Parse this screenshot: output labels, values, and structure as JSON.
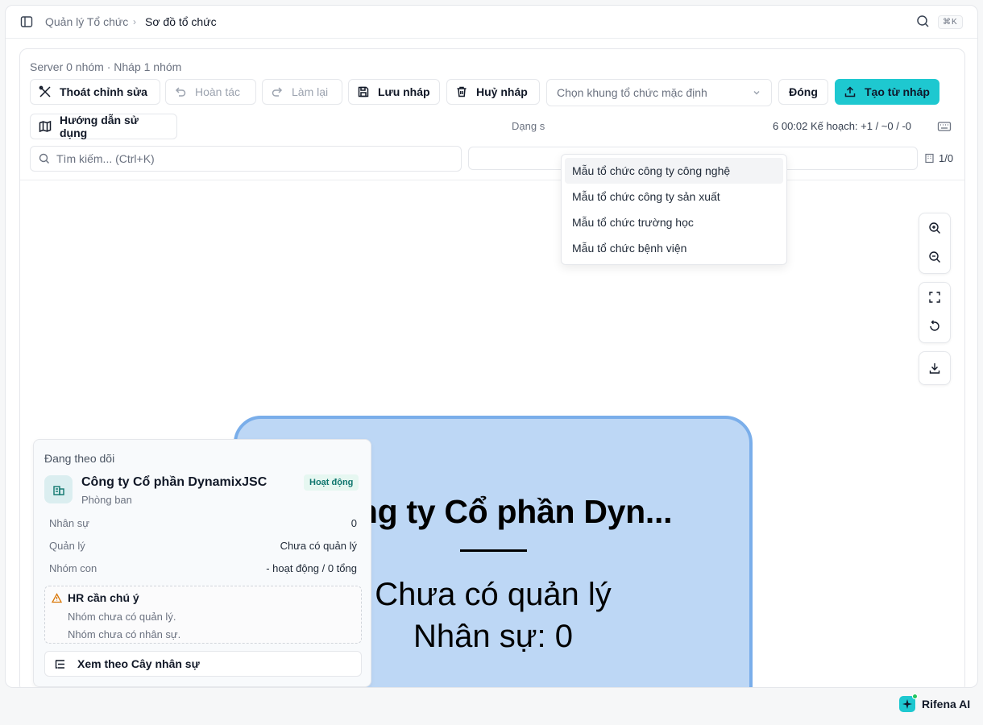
{
  "breadcrumb": {
    "parent": "Quản lý Tổ chức",
    "separator": "›",
    "current": "Sơ đồ tổ chức"
  },
  "header": {
    "shortcut": "⌘K"
  },
  "summary": "Server 0 nhóm · Nháp 1 nhóm",
  "toolbar": {
    "exit_edit": "Thoát chỉnh sửa",
    "undo": "Hoàn tác",
    "redo": "Làm lại",
    "save_draft": "Lưu nháp",
    "cancel_draft": "Huỷ nháp",
    "template_placeholder": "Chọn khung tổ chức mặc định",
    "close": "Đóng",
    "create_from_draft": "Tạo từ nháp",
    "guide": "Hướng dẫn sử dụng"
  },
  "status": {
    "left": "Dạng s",
    "right": "6 00:02  Kế hoạch: +1 / ~0 / -0"
  },
  "search": {
    "placeholder": "Tìm kiếm... (Ctrl+K)",
    "count": "1/0"
  },
  "dropdown": {
    "items": [
      "Mẫu tổ chức công ty công nghệ",
      "Mẫu tổ chức công ty sản xuất",
      "Mẫu tổ chức trường học",
      "Mẫu tổ chức bệnh viện"
    ],
    "highlighted_index": 0
  },
  "node": {
    "title": "Công ty Cổ phần Dyn...",
    "manager": "Chưa có quản lý",
    "staff": "Nhân sự: 0",
    "fill": "#bdd7f5",
    "border": "#7aaeea"
  },
  "inspector": {
    "heading": "Đang theo dõi",
    "name": "Công ty Cổ phần DynamixJSC",
    "type": "Phòng ban",
    "badge": "Hoạt động",
    "rows": [
      {
        "label": "Nhân sự",
        "value": "0"
      },
      {
        "label": "Quản lý",
        "value": "Chưa có quản lý"
      },
      {
        "label": "Nhóm con",
        "value": "- hoạt động / 0 tổng"
      }
    ],
    "alert": {
      "title": "HR cần chú ý",
      "lines": [
        "Nhóm chưa có quản lý.",
        "Nhóm chưa có nhân sự."
      ]
    },
    "tree_button": "Xem theo Cây nhân sự"
  },
  "assistant": {
    "label": "Rifena AI"
  },
  "colors": {
    "accent": "#1ec8d0",
    "badge_bg": "#e6f7f1",
    "badge_text": "#0f766e"
  }
}
